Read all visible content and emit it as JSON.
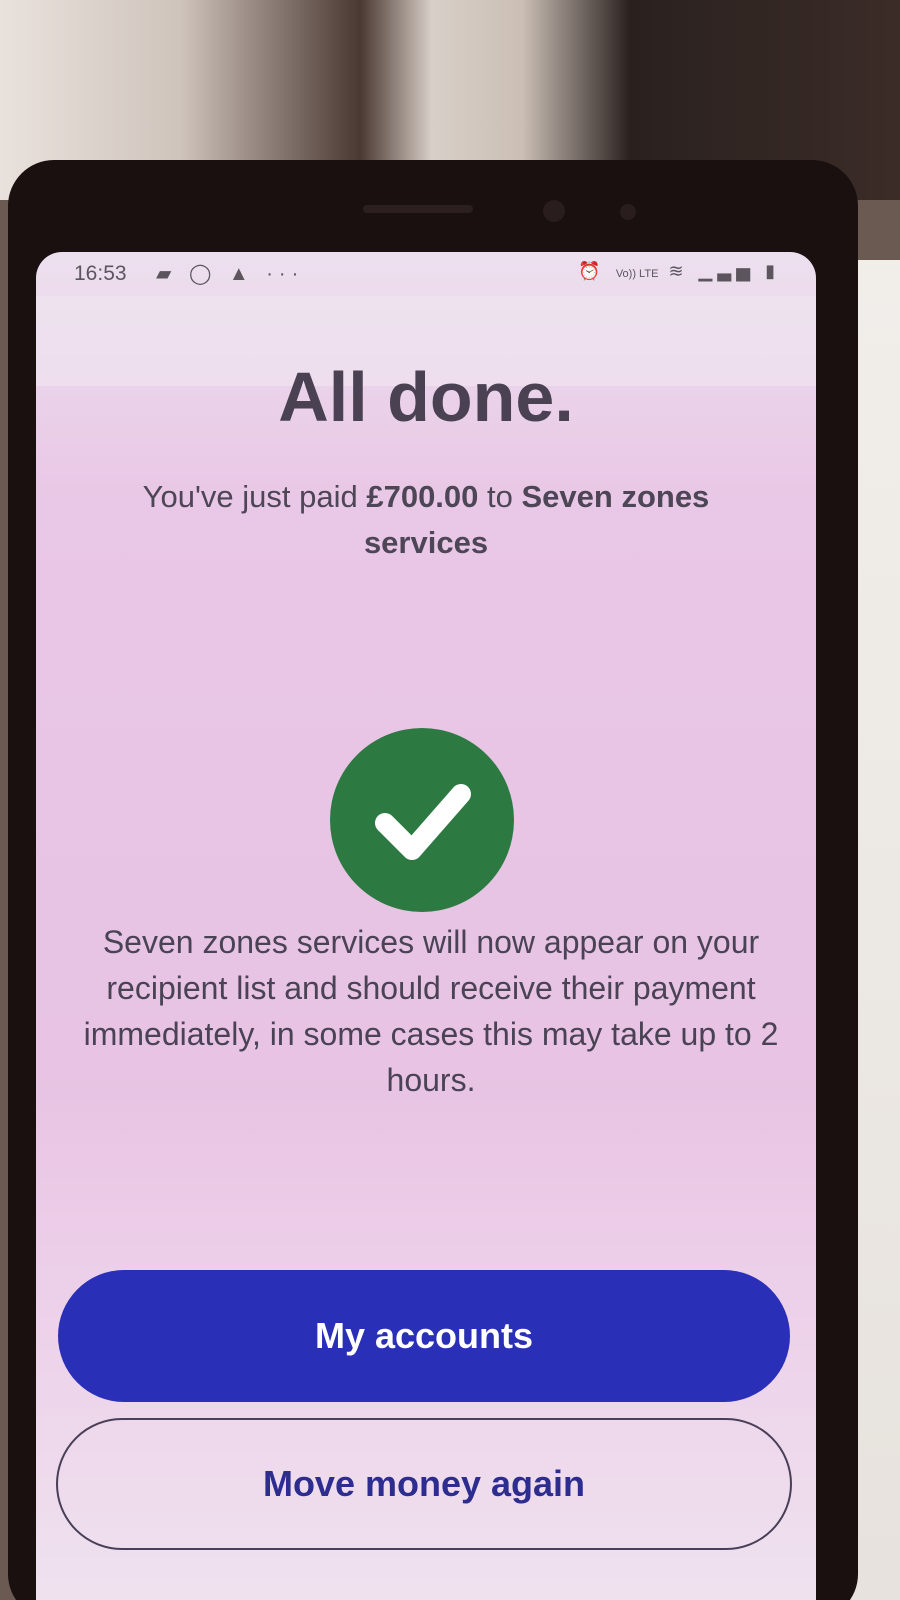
{
  "status_bar": {
    "time": "16:53",
    "left_icons": [
      "message-icon",
      "whatsapp-icon",
      "snapchat-icon",
      "more-icon"
    ],
    "right_icons": [
      "alarm-icon",
      "volte-icon",
      "wifi-icon",
      "signal-icon",
      "battery-icon"
    ],
    "volte_label": "Vo)) LTE",
    "more_label": "···"
  },
  "confirmation": {
    "title": "All done.",
    "paid_prefix": "You've just paid ",
    "amount": "£700.00",
    "paid_middle": " to ",
    "recipient": "Seven zones services",
    "success_icon": "check-icon",
    "success_color": "#2c7a42",
    "info": "Seven zones services will now appear on your recipient list and should receive their payment immediately, in some cases this may take up to 2 hours."
  },
  "actions": {
    "primary_label": "My accounts",
    "primary_color": "#2a2fb8",
    "secondary_label": "Move money again"
  }
}
